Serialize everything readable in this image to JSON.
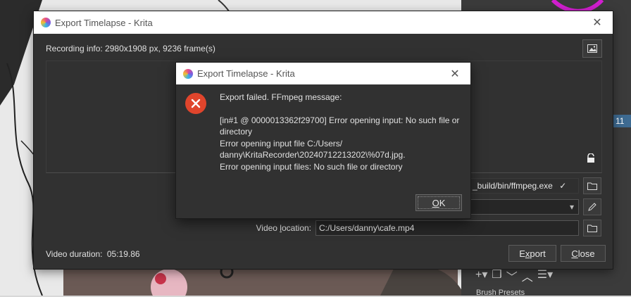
{
  "dock": {
    "selected_number": "11",
    "brush_presets_label": "Brush Presets"
  },
  "main_dialog": {
    "title": "Export Timelapse - Krita",
    "recording_info": "Recording info: 2980x1908 px, 9236 frame(s)",
    "ffmpeg_path": "_build/bin/ffmpeg.exe",
    "video_location_label": "Video location:",
    "video_location_value": "C:/Users/danny\\cafe.mp4",
    "video_duration_label": "Video duration:",
    "video_duration_value": "05:19.86",
    "export_button": "Export",
    "close_button": "Close"
  },
  "error_dialog": {
    "title": "Export Timelapse - Krita",
    "lines": [
      "Export failed. FFmpeg message:",
      "",
      "[in#1 @ 0000013362f29700] Error opening input: No such file or directory",
      "Error opening input file C:/Users/ danny\\KritaRecorder\\20240712213202\\%07d.jpg.",
      "Error opening input files: No such file or directory"
    ],
    "ok_button": "OK"
  },
  "colors": {
    "accent": "#3e6b92",
    "error": "#e0452c",
    "dialog_bg": "#313131"
  }
}
